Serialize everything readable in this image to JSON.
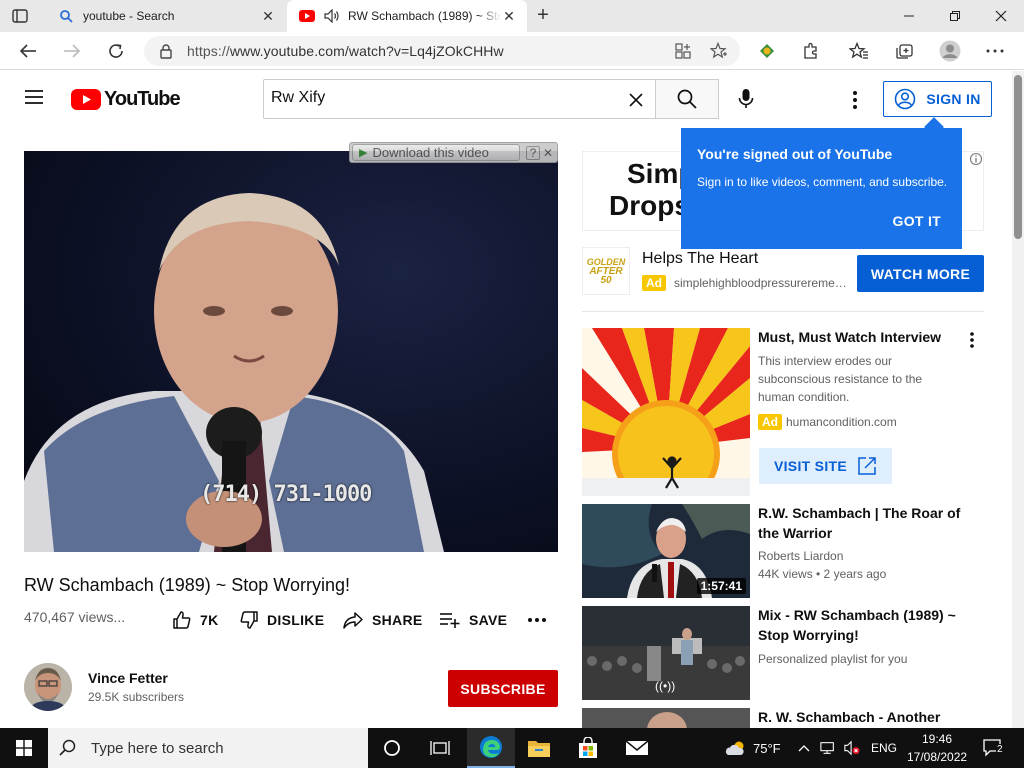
{
  "browser": {
    "tabs": [
      {
        "title": "youtube - Search",
        "active": false
      },
      {
        "title": "RW Schambach (1989) ~ Stop Worrying! - YouTube",
        "active": true
      }
    ],
    "url_prefix": "https://",
    "url_rest": "www.youtube.com/watch?v=Lq4jZOkCHHw"
  },
  "youtube": {
    "logo_text": "YouTube",
    "search_value": "Rw Xify",
    "signin_label": "SIGN IN"
  },
  "player": {
    "download_label": "Download this video",
    "help_label": "?",
    "close_label": "✕",
    "overlay_phone": "(714) 731-1000"
  },
  "video": {
    "title": "RW Schambach (1989) ~ Stop Worrying!",
    "views": "470,467 views...",
    "likes": "7K",
    "dislike_label": "DISLIKE",
    "share_label": "SHARE",
    "save_label": "SAVE"
  },
  "channel": {
    "name": "Vince Fetter",
    "subscribers": "29.5K subscribers",
    "subscribe_label": "SUBSCRIBE"
  },
  "popup": {
    "title": "You're signed out of YouTube",
    "text": "Sign in to like videos, comment, and subscribe.",
    "button": "GOT IT"
  },
  "ad_top": {
    "banner_line1": "Simp",
    "banner_line2": "Drops",
    "logo_line1": "GOLDEN",
    "logo_line2": "AFTER 50",
    "headline": "Helps The Heart",
    "badge": "Ad",
    "domain": "simplehighbloodpressureremedies.com",
    "button": "WATCH MORE"
  },
  "recommendations": [
    {
      "title": "Must, Must Watch Interview",
      "description": "This interview erodes our subconscious resistance to the human condition.",
      "badge": "Ad",
      "domain": "humancondition.com",
      "button": "VISIT SITE"
    },
    {
      "title": "R.W. Schambach | The Roar of the Warrior",
      "channel": "Roberts Liardon",
      "meta": "44K views • 2 years ago",
      "duration": "1:57:41"
    },
    {
      "title": "Mix - RW Schambach (1989) ~ Stop Worrying!",
      "meta": "Personalized playlist for you",
      "overlay": "((•))"
    },
    {
      "title": "R. W. Schambach - Another"
    }
  ],
  "taskbar": {
    "search_placeholder": "Type here to search",
    "temperature": "75°F",
    "language": "ENG",
    "time": "19:46",
    "date": "17/08/2022",
    "notifications": "2"
  }
}
